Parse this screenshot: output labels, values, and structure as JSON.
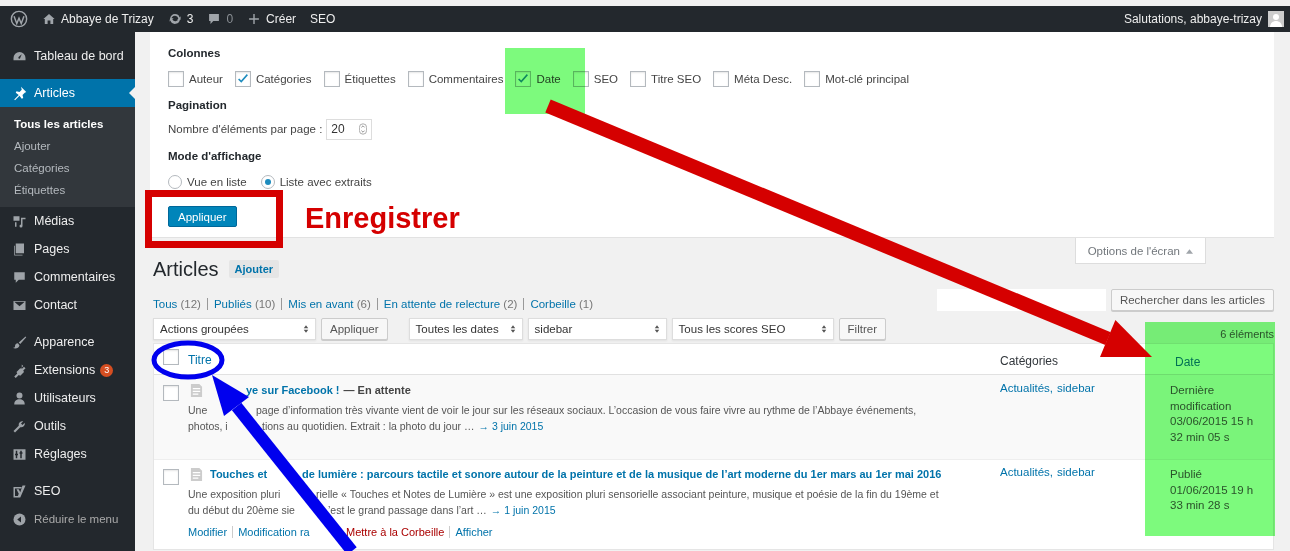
{
  "admin_bar": {
    "site_name": "Abbaye de Trizay",
    "updates": "3",
    "comments": "0",
    "new_label": "Créer",
    "seo_label": "SEO",
    "greeting": "Salutations, abbaye-trizay"
  },
  "sidebar": {
    "sections": [
      {
        "items": [
          {
            "label": "Tableau de bord",
            "selected": false
          }
        ]
      },
      {
        "items": [
          {
            "label": "Articles",
            "selected": true,
            "children": [
              {
                "label": "Tous les articles",
                "selected": true
              },
              {
                "label": "Ajouter",
                "selected": false
              },
              {
                "label": "Catégories",
                "selected": false
              },
              {
                "label": "Étiquettes",
                "selected": false
              }
            ]
          },
          {
            "label": "Médias",
            "selected": false
          },
          {
            "label": "Pages",
            "selected": false
          },
          {
            "label": "Commentaires",
            "selected": false
          },
          {
            "label": "Contact",
            "selected": false
          }
        ]
      },
      {
        "items": [
          {
            "label": "Apparence",
            "selected": false
          },
          {
            "label": "Extensions",
            "selected": false,
            "badge": "3"
          },
          {
            "label": "Utilisateurs",
            "selected": false
          },
          {
            "label": "Outils",
            "selected": false
          },
          {
            "label": "Réglages",
            "selected": false
          }
        ]
      },
      {
        "items": [
          {
            "label": "SEO",
            "selected": false
          }
        ]
      }
    ],
    "collapse_label": "Réduire le menu"
  },
  "screen_options": {
    "columns_heading": "Colonnes",
    "columns": [
      {
        "label": "Auteur",
        "checked": false
      },
      {
        "label": "Catégories",
        "checked": true
      },
      {
        "label": "Étiquettes",
        "checked": false
      },
      {
        "label": "Commentaires",
        "checked": false
      },
      {
        "label": "Date",
        "checked": true
      },
      {
        "label": "SEO",
        "checked": false
      },
      {
        "label": "Titre SEO",
        "checked": false
      },
      {
        "label": "Méta Desc.",
        "checked": false
      },
      {
        "label": "Mot-clé principal",
        "checked": false
      }
    ],
    "pagination_heading": "Pagination",
    "per_page_label": "Nombre d'éléments par page :",
    "per_page_value": "20",
    "view_mode_heading": "Mode d'affichage",
    "view_modes": [
      {
        "label": "Vue en liste",
        "selected": false
      },
      {
        "label": "Liste avec extraits",
        "selected": true
      }
    ],
    "apply_button": "Appliquer",
    "tab_label": "Options de l'écran",
    "expanded": true
  },
  "page": {
    "title": "Articles",
    "add_button": "Ajouter"
  },
  "status_filters": [
    {
      "label": "Tous",
      "count": "(12)"
    },
    {
      "label": "Publiés",
      "count": "(10)"
    },
    {
      "label": "Mis en avant",
      "count": "(6)"
    },
    {
      "label": "En attente de relecture",
      "count": "(2)"
    },
    {
      "label": "Corbeille",
      "count": "(1)"
    }
  ],
  "search": {
    "button": "Rechercher dans les articles"
  },
  "toolbar": {
    "bulk_actions": "Actions groupées",
    "apply_button": "Appliquer",
    "filters": [
      "Toutes les dates",
      "sidebar",
      "Tous les scores SEO"
    ],
    "filter_button": "Filtrer",
    "items_count": "6 éléments"
  },
  "table": {
    "select_all_checked": false,
    "columns": [
      {
        "label": "Titre",
        "kind": "sortable"
      },
      {
        "label": "Catégories",
        "kind": "plain"
      },
      {
        "label": "Date",
        "kind": "sortable"
      }
    ],
    "rows": [
      {
        "checked": false,
        "title_fragments": [
          "ye sur Facebook !"
        ],
        "post_state": "— En attente",
        "excerpt_lines": [
          {
            "fragments": [
              "Une",
              "page d’information très vivante vient de voir le jour sur les réseaux sociaux. L’occasion de vous faire vivre au rythme de l’Abbaye événements,"
            ]
          },
          {
            "fragments": [
              "photos, i",
              "tions au quotidien. Extrait  : la photo du jour  …"
            ],
            "link": "→ 3 juin 2015"
          }
        ],
        "categories": [
          "Actualités,",
          "sidebar"
        ],
        "date_status": "Dernière modification",
        "date_value": "03/06/2015 15 h 32 min 05 s"
      },
      {
        "checked": false,
        "title_fragments": [
          "Touches et",
          "de lumière : parcours tactile et sonore autour de la peinture et de la musique de l’art moderne du 1er mars au 1er mai 2016"
        ],
        "excerpt_lines": [
          {
            "fragments": [
              "Une exposition pluri",
              "rielle « Touches et Notes de Lumière » est une exposition pluri sensorielle associant peinture, musique et poésie de la fin du 19ème et"
            ]
          },
          {
            "fragments": [
              "du début du 20ème sie",
              "’est le grand passage dans l’art …"
            ],
            "link": "→ 1 juin 2015"
          }
        ],
        "action_groups": [
          [
            {
              "label": "Modifier",
              "kind": "link"
            },
            {
              "label": "Modification ra",
              "kind": "link"
            }
          ],
          [
            {
              "label": "Mettre à la Corbeille",
              "kind": "danger"
            },
            {
              "label": "Afficher",
              "kind": "link"
            }
          ]
        ],
        "categories": [
          "Actualités,",
          "sidebar"
        ],
        "date_status": "Publié",
        "date_value": "01/06/2015 19 h 33 min 28 s"
      }
    ]
  },
  "annotations": {
    "label": "Enregistrer"
  }
}
